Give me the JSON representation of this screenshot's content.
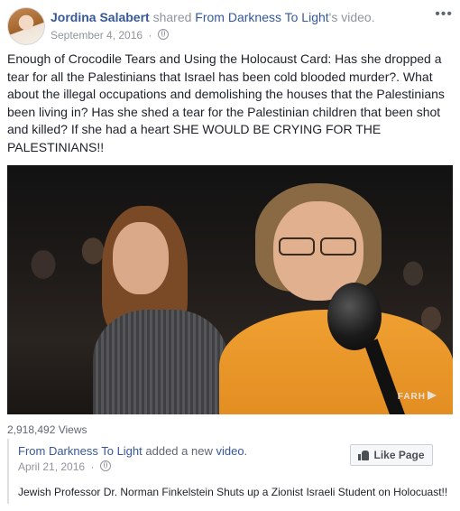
{
  "post": {
    "author": "Jordina Salabert",
    "shared_text": "shared",
    "shared_page": "From Darkness To Light",
    "shared_suffix": "'s video.",
    "date": "September 4, 2016",
    "separator": "·",
    "more_icon": "more-options-icon",
    "body": "Enough of Crocodile Tears and Using the Holocaust Card: Has she dropped a tear for all the Palestinians that Israel has been cold blooded murder?. What about the illegal occupations and demolishing the houses that the Palestinians been living in? Has she shed a tear for the Palestinian children that been shot and killed? If she had a heart SHE WOULD BE CRYING FOR THE PALESTINIANS!!"
  },
  "video": {
    "watermark": "FARH"
  },
  "stats": {
    "views": "2,918,492 Views"
  },
  "original": {
    "page": "From Darkness To Light",
    "added_text": "added a new",
    "video_link": "video",
    "period": ".",
    "date": "April 21, 2016",
    "separator": "·",
    "like_button": "Like Page",
    "description": "Jewish Professor Dr. Norman Finkelstein Shuts up a Zionist Israeli Student on Holocuast!!"
  },
  "colors": {
    "link": "#365899",
    "muted": "#90949c",
    "text": "#1d2129",
    "hoodie": "#e08a1e"
  }
}
